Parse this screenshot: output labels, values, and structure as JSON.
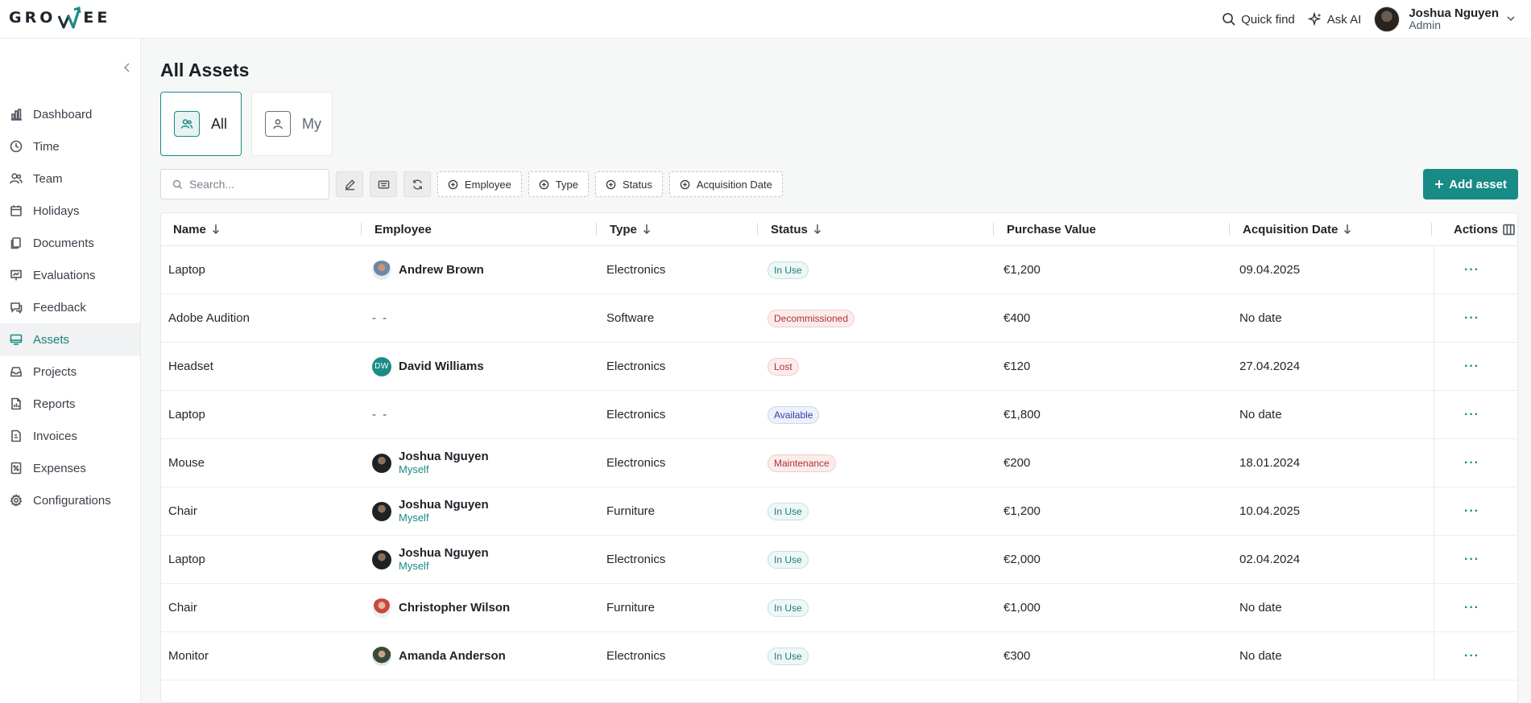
{
  "brand": {
    "logo_left": "GRO",
    "logo_right": "EE"
  },
  "header": {
    "quick_find": "Quick find",
    "ask_ai": "Ask AI",
    "user_name": "Joshua Nguyen",
    "user_role": "Admin"
  },
  "sidebar": {
    "items": [
      {
        "label": "Dashboard",
        "icon": "bar-chart-icon"
      },
      {
        "label": "Time",
        "icon": "clock-icon"
      },
      {
        "label": "Team",
        "icon": "users-icon"
      },
      {
        "label": "Holidays",
        "icon": "calendar-icon"
      },
      {
        "label": "Documents",
        "icon": "documents-icon"
      },
      {
        "label": "Evaluations",
        "icon": "presentation-icon"
      },
      {
        "label": "Feedback",
        "icon": "chat-icon"
      },
      {
        "label": "Assets",
        "icon": "monitor-icon"
      },
      {
        "label": "Projects",
        "icon": "inbox-icon"
      },
      {
        "label": "Reports",
        "icon": "report-icon"
      },
      {
        "label": "Invoices",
        "icon": "invoice-icon"
      },
      {
        "label": "Expenses",
        "icon": "receipt-icon"
      },
      {
        "label": "Configurations",
        "icon": "gear-icon"
      }
    ],
    "active": "Assets"
  },
  "page": {
    "title": "All Assets",
    "scope_tabs": [
      {
        "label": "All",
        "active": true
      },
      {
        "label": "My",
        "active": false
      }
    ]
  },
  "toolbar": {
    "search_placeholder": "Search...",
    "filters": [
      "Employee",
      "Type",
      "Status",
      "Acquisition Date"
    ],
    "add_label": "Add asset"
  },
  "table": {
    "columns": [
      "Name",
      "Employee",
      "Type",
      "Status",
      "Purchase Value",
      "Acquisition Date",
      "Actions"
    ],
    "rows": [
      {
        "name": "Laptop",
        "employee": "Andrew Brown",
        "sub": "",
        "avatar": "photo1",
        "type": "Electronics",
        "status": "In Use",
        "value": "€1,200",
        "date": "09.04.2025"
      },
      {
        "name": "Adobe Audition",
        "employee": "- -",
        "sub": "",
        "avatar": "",
        "type": "Software",
        "status": "Decommissioned",
        "value": "€400",
        "date": "No date"
      },
      {
        "name": "Headset",
        "employee": "David Williams",
        "sub": "",
        "avatar": "initials",
        "initials": "DW",
        "type": "Electronics",
        "status": "Lost",
        "value": "€120",
        "date": "27.04.2024"
      },
      {
        "name": "Laptop",
        "employee": "- -",
        "sub": "",
        "avatar": "",
        "type": "Electronics",
        "status": "Available",
        "value": "€1,800",
        "date": "No date"
      },
      {
        "name": "Mouse",
        "employee": "Joshua Nguyen",
        "sub": "Myself",
        "avatar": "photo2",
        "type": "Electronics",
        "status": "Maintenance",
        "value": "€200",
        "date": "18.01.2024"
      },
      {
        "name": "Chair",
        "employee": "Joshua Nguyen",
        "sub": "Myself",
        "avatar": "photo2",
        "type": "Furniture",
        "status": "In Use",
        "value": "€1,200",
        "date": "10.04.2025"
      },
      {
        "name": "Laptop",
        "employee": "Joshua Nguyen",
        "sub": "Myself",
        "avatar": "photo2",
        "type": "Electronics",
        "status": "In Use",
        "value": "€2,000",
        "date": "02.04.2024"
      },
      {
        "name": "Chair",
        "employee": "Christopher Wilson",
        "sub": "",
        "avatar": "photo3",
        "type": "Furniture",
        "status": "In Use",
        "value": "€1,000",
        "date": "No date"
      },
      {
        "name": "Monitor",
        "employee": "Amanda Anderson",
        "sub": "",
        "avatar": "photo4",
        "type": "Electronics",
        "status": "In Use",
        "value": "€300",
        "date": "No date"
      }
    ],
    "actions_symbol": "···"
  },
  "colors": {
    "accent": "#188b86",
    "sidebar_active_text": "#1b7f7a"
  }
}
